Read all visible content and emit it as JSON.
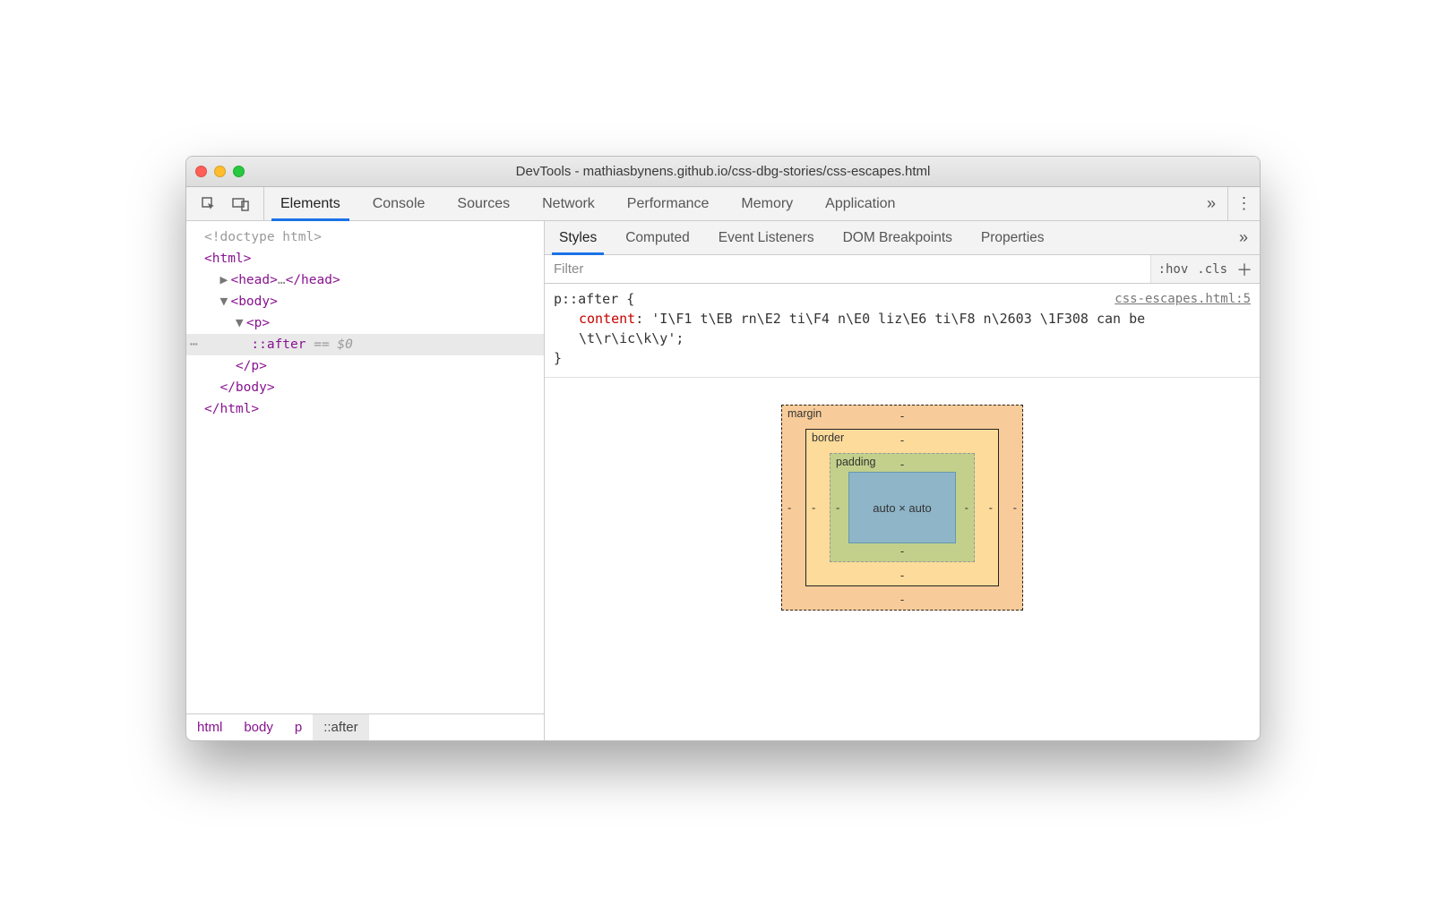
{
  "window": {
    "title": "DevTools - mathiasbynens.github.io/css-dbg-stories/css-escapes.html"
  },
  "toolbar": {
    "tabs": [
      "Elements",
      "Console",
      "Sources",
      "Network",
      "Performance",
      "Memory",
      "Application"
    ],
    "activeTab": 0
  },
  "dom": {
    "lines": [
      {
        "text": "<!doctype html>",
        "cls": "doctype",
        "indent": 0
      },
      {
        "text": "<html>",
        "cls": "tagc",
        "indent": 0
      },
      {
        "text": "<head>…</head>",
        "cls": "headline",
        "indent": 1,
        "arrow": "▶"
      },
      {
        "text": "<body>",
        "cls": "tagc",
        "indent": 1,
        "arrow": "▼"
      },
      {
        "text": "<p>",
        "cls": "tagc",
        "indent": 2,
        "arrow": "▼"
      },
      {
        "text": "::after",
        "cls": "pseudo",
        "indent": 3,
        "selected": true,
        "suffix": " == $0"
      },
      {
        "text": "</p>",
        "cls": "tagc",
        "indent": 2
      },
      {
        "text": "</body>",
        "cls": "tagc",
        "indent": 1
      },
      {
        "text": "</html>",
        "cls": "tagc",
        "indent": 0
      }
    ]
  },
  "breadcrumbs": [
    "html",
    "body",
    "p",
    "::after"
  ],
  "styles": {
    "subtabs": [
      "Styles",
      "Computed",
      "Event Listeners",
      "DOM Breakpoints",
      "Properties"
    ],
    "activeSubtab": 0,
    "filterPlaceholder": "Filter",
    "hov": ":hov",
    "cls": ".cls",
    "rule": {
      "selector": "p::after {",
      "source": "css-escapes.html:5",
      "declProp": "content",
      "declVal": "'I\\F1 t\\EB rn\\E2 ti\\F4 n\\E0 liz\\E6 ti\\F8 n\\2603 \\1F308 can be \\t\\r\\ic\\k\\y';",
      "close": "}"
    }
  },
  "boxModel": {
    "marginLabel": "margin",
    "borderLabel": "border",
    "paddingLabel": "padding",
    "dash": "-",
    "content": "auto × auto"
  }
}
